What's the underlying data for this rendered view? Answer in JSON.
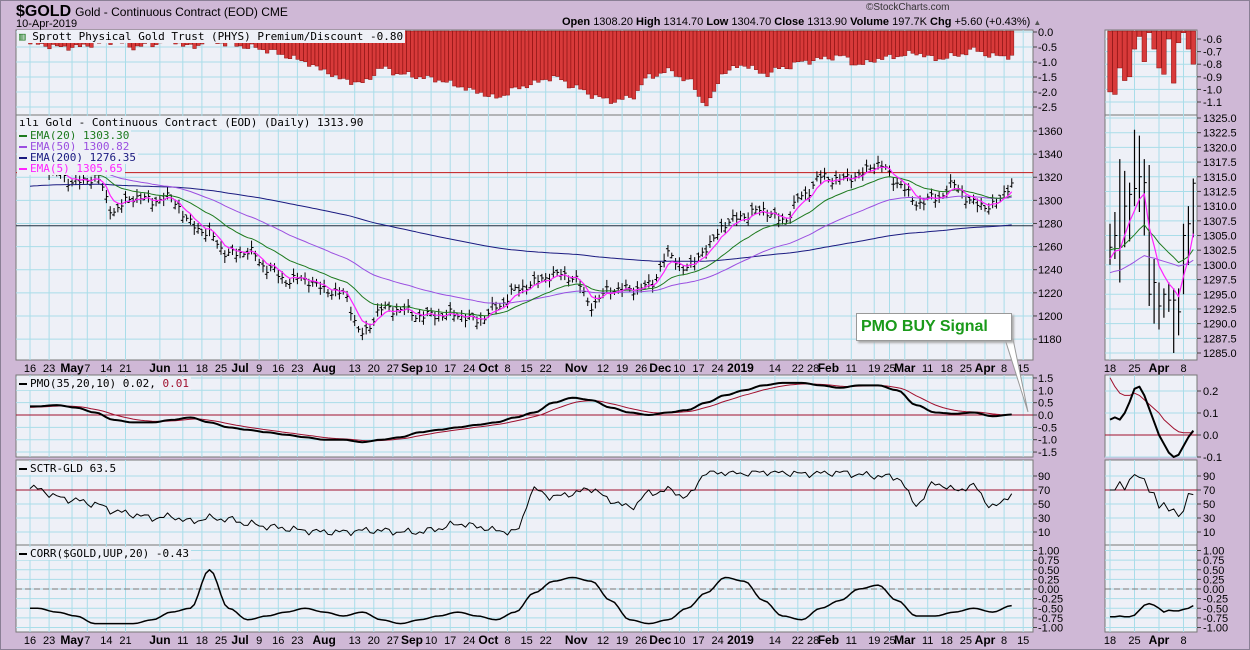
{
  "header": {
    "symbol": "$GOLD",
    "description": "Gold - Continuous Contract (EOD)",
    "exchange": "CME",
    "date": "10-Apr-2019",
    "brand": "©StockCharts.com",
    "open_label": "Open",
    "open": "1308.20",
    "high_label": "High",
    "high": "1314.70",
    "low_label": "Low",
    "low": "1304.70",
    "close_label": "Close",
    "close": "1313.90",
    "volume_label": "Volume",
    "volume": "197.7K",
    "chg_label": "Chg",
    "chg": "+5.60 (+0.43%)"
  },
  "panels": {
    "phys": {
      "label": "Sprott Physical Gold Trust (PHYS) Premium/Discount -0.80"
    },
    "price": {
      "label": "Gold - Continuous Contract (EOD) (Daily) 1313.90",
      "ema20": "EMA(20) 1303.30",
      "ema50": "EMA(50) 1300.82",
      "ema200": "EMA(200) 1276.35",
      "ema5": "EMA(5) 1305.65"
    },
    "pmo": {
      "label": "PMO(35,20,10) 0.02,",
      "signal_label": "0.01"
    },
    "sctr": {
      "label": "SCTR-GLD 63.5"
    },
    "corr": {
      "label": "CORR($GOLD,UUP,20) -0.43"
    }
  },
  "annotation": {
    "text": "PMO BUY Signal"
  },
  "colors": {
    "bar": "#d83a3a",
    "ema20": "#1e7a1e",
    "ema50": "#9b4fe0",
    "ema200": "#1a1a80",
    "ema5": "#ff22ff",
    "signal": "#a0102e",
    "grid": "#a9dde9",
    "panel": "#eef0f7"
  },
  "chart_data": [
    {
      "type": "line",
      "title": "Gold - Continuous Contract (EOD) (Daily)",
      "note": "weekly closes, week starting 16-Apr-2018 through week of 8-Apr-2019",
      "weekly_close": [
        1335,
        1323,
        1315,
        1320,
        1291,
        1303,
        1300,
        1302,
        1280,
        1270,
        1253,
        1256,
        1242,
        1231,
        1232,
        1223,
        1219,
        1184,
        1206,
        1206,
        1200,
        1201,
        1201,
        1196,
        1207,
        1222,
        1229,
        1236,
        1234,
        1210,
        1223,
        1223,
        1226,
        1252,
        1241,
        1258,
        1280,
        1287,
        1292,
        1282,
        1303,
        1320,
        1318,
        1322,
        1332,
        1316,
        1298,
        1302,
        1313,
        1297,
        1295,
        1314
      ],
      "yticks": [
        "1360",
        "1340",
        "1320",
        "1300",
        "1280",
        "1260",
        "1240",
        "1220",
        "1200",
        "1180"
      ],
      "ylim": [
        1165,
        1372
      ],
      "hlines": [
        1324,
        1278
      ]
    },
    {
      "type": "bar",
      "title": "Sprott Physical Gold Trust (PHYS) Premium/Discount",
      "weekly_values": [
        -0.4,
        -0.5,
        -0.5,
        -0.4,
        -0.3,
        -0.5,
        -0.4,
        -0.3,
        -0.5,
        -0.3,
        -0.4,
        -0.5,
        -0.6,
        -0.8,
        -1.0,
        -1.3,
        -1.6,
        -1.7,
        -1.2,
        -1.4,
        -1.5,
        -1.6,
        -1.8,
        -2.0,
        -2.2,
        -1.9,
        -1.7,
        -1.5,
        -1.8,
        -2.1,
        -2.3,
        -2.2,
        -1.5,
        -1.3,
        -1.6,
        -2.4,
        -1.3,
        -1.1,
        -1.4,
        -1.2,
        -1.0,
        -0.9,
        -0.8,
        -1.1,
        -0.9,
        -0.8,
        -0.7,
        -0.9,
        -0.8,
        -0.6,
        -0.8,
        -0.8
      ],
      "yticks": [
        "0.0",
        "-0.5",
        "-1.0",
        "-1.5",
        "-2.0",
        "-2.5"
      ]
    },
    {
      "type": "line",
      "title": "PMO(35,20,10)",
      "weekly_values": [
        0.35,
        0.4,
        0.3,
        0.1,
        -0.2,
        -0.3,
        -0.3,
        -0.2,
        -0.1,
        -0.3,
        -0.5,
        -0.6,
        -0.7,
        -0.8,
        -0.9,
        -1.0,
        -1.0,
        -1.1,
        -1.0,
        -0.9,
        -0.7,
        -0.6,
        -0.5,
        -0.4,
        -0.3,
        -0.1,
        0.1,
        0.5,
        0.7,
        0.6,
        0.3,
        0.1,
        0.0,
        0.1,
        0.2,
        0.5,
        0.8,
        1.0,
        1.2,
        1.3,
        1.3,
        1.2,
        1.1,
        1.2,
        1.2,
        1.0,
        0.4,
        0.1,
        0.05,
        0.1,
        -0.05,
        0.02
      ],
      "yticks": [
        "1.5",
        "1.0",
        "0.5",
        "0.0",
        "-0.5",
        "-1.0",
        "-1.5"
      ],
      "hline": 0
    },
    {
      "type": "line",
      "title": "SCTR-GLD",
      "weekly_values": [
        72,
        60,
        55,
        50,
        40,
        35,
        30,
        32,
        25,
        30,
        28,
        22,
        18,
        15,
        12,
        10,
        10,
        12,
        12,
        10,
        10,
        15,
        22,
        18,
        12,
        10,
        70,
        60,
        65,
        72,
        55,
        45,
        65,
        70,
        60,
        95,
        95,
        94,
        96,
        95,
        93,
        94,
        95,
        92,
        90,
        88,
        50,
        80,
        70,
        75,
        45,
        63.5
      ],
      "yticks": [
        "90",
        "70",
        "50",
        "30",
        "10"
      ],
      "hline": 70
    },
    {
      "type": "line",
      "title": "CORR($GOLD,UUP,20)",
      "weekly_values": [
        -0.5,
        -0.6,
        -0.7,
        -0.9,
        -0.9,
        -0.9,
        -0.8,
        -0.6,
        -0.5,
        0.5,
        -0.5,
        -0.8,
        -0.7,
        -0.6,
        -0.5,
        -0.6,
        -0.7,
        -0.6,
        -0.8,
        -0.9,
        -0.8,
        -0.7,
        -0.6,
        -0.7,
        -0.8,
        -0.6,
        -0.1,
        0.2,
        0.3,
        0.2,
        -0.3,
        -0.8,
        -0.9,
        -0.8,
        -0.5,
        -0.1,
        0.3,
        0.2,
        -0.3,
        -0.7,
        -0.8,
        -0.5,
        -0.3,
        0.0,
        0.1,
        -0.3,
        -0.7,
        -0.7,
        -0.6,
        -0.5,
        -0.6,
        -0.43
      ],
      "yticks": [
        "1.00",
        "0.75",
        "0.50",
        "0.25",
        "0.00",
        "-0.25",
        "-0.50",
        "-0.75",
        "-1.00"
      ]
    }
  ],
  "x_ticks": [
    {
      "label": "16",
      "day": 0
    },
    {
      "label": "23",
      "day": 5
    },
    {
      "label": "May",
      "day": 11,
      "bold": true
    },
    {
      "label": "7",
      "day": 15
    },
    {
      "label": "14",
      "day": 20
    },
    {
      "label": "21",
      "day": 25
    },
    {
      "label": "Jun",
      "day": 34,
      "bold": true
    },
    {
      "label": "11",
      "day": 40
    },
    {
      "label": "18",
      "day": 45
    },
    {
      "label": "25",
      "day": 50
    },
    {
      "label": "Jul",
      "day": 55,
      "bold": true
    },
    {
      "label": "9",
      "day": 60
    },
    {
      "label": "16",
      "day": 65
    },
    {
      "label": "23",
      "day": 70
    },
    {
      "label": "Aug",
      "day": 77,
      "bold": true
    },
    {
      "label": "13",
      "day": 85
    },
    {
      "label": "20",
      "day": 90
    },
    {
      "label": "27",
      "day": 95
    },
    {
      "label": "Sep",
      "day": 100,
      "bold": true
    },
    {
      "label": "10",
      "day": 105
    },
    {
      "label": "17",
      "day": 110
    },
    {
      "label": "24",
      "day": 115
    },
    {
      "label": "Oct",
      "day": 120,
      "bold": true
    },
    {
      "label": "8",
      "day": 125
    },
    {
      "label": "15",
      "day": 130
    },
    {
      "label": "22",
      "day": 135
    },
    {
      "label": "Nov",
      "day": 143,
      "bold": true
    },
    {
      "label": "12",
      "day": 150
    },
    {
      "label": "19",
      "day": 155
    },
    {
      "label": "26",
      "day": 160
    },
    {
      "label": "Dec",
      "day": 165,
      "bold": true
    },
    {
      "label": "10",
      "day": 170
    },
    {
      "label": "17",
      "day": 175
    },
    {
      "label": "24",
      "day": 180
    },
    {
      "label": "2019",
      "day": 186,
      "bold": true
    },
    {
      "label": "14",
      "day": 195
    },
    {
      "label": "22",
      "day": 201
    },
    {
      "label": "28",
      "day": 205
    },
    {
      "label": "Feb",
      "day": 209,
      "bold": true
    },
    {
      "label": "11",
      "day": 215
    },
    {
      "label": "19",
      "day": 221
    },
    {
      "label": "25",
      "day": 225
    },
    {
      "label": "Mar",
      "day": 229,
      "bold": true
    },
    {
      "label": "11",
      "day": 235
    },
    {
      "label": "18",
      "day": 240
    },
    {
      "label": "25",
      "day": 245
    },
    {
      "label": "Apr",
      "day": 250,
      "bold": true
    },
    {
      "label": "8",
      "day": 255
    },
    {
      "label": "15",
      "day": 260
    }
  ],
  "inset": {
    "x_ticks": [
      {
        "label": "18",
        "day": 0
      },
      {
        "label": "25",
        "day": 5
      },
      {
        "label": "Apr",
        "day": 10,
        "bold": true
      },
      {
        "label": "8",
        "day": 15
      }
    ],
    "price": {
      "high": [
        1307,
        1309,
        1318,
        1316,
        1314,
        1323,
        1322,
        1318,
        1317,
        1301,
        1297,
        1296,
        1297,
        1296,
        1296,
        1307,
        1310,
        1314.7
      ],
      "low": [
        1300,
        1301,
        1297,
        1303,
        1304,
        1310,
        1309,
        1305,
        1293,
        1290,
        1289,
        1291,
        1292,
        1285,
        1288,
        1295,
        1300,
        1304.7
      ],
      "close": [
        1303,
        1305,
        1303,
        1310,
        1312,
        1313,
        1315,
        1314,
        1295,
        1297,
        1293,
        1295,
        1294,
        1294,
        1292,
        1305,
        1307,
        1313.9
      ],
      "yticks": [
        "1325.0",
        "1322.5",
        "1320.0",
        "1317.5",
        "1315.0",
        "1312.5",
        "1310.0",
        "1307.5",
        "1305.0",
        "1302.5",
        "1300.0",
        "1297.5",
        "1295.0",
        "1292.5",
        "1290.0",
        "1287.5",
        "1285.0"
      ]
    },
    "phys": {
      "values": [
        -1.02,
        -1.04,
        -0.83,
        -0.93,
        -0.9,
        -0.68,
        -0.58,
        -0.78,
        -0.55,
        -0.68,
        -0.83,
        -0.88,
        -0.6,
        -0.95,
        -0.63,
        -0.55,
        -0.68,
        -0.8
      ],
      "yticks": [
        "-0.6",
        "-0.7",
        "-0.8",
        "-0.9",
        "-1.0",
        "-1.1"
      ]
    },
    "pmo": {
      "values": [
        0.07,
        0.08,
        0.07,
        0.1,
        0.15,
        0.21,
        0.22,
        0.18,
        0.12,
        0.06,
        0.0,
        -0.04,
        -0.08,
        -0.1,
        -0.09,
        -0.05,
        -0.01,
        0.02
      ],
      "signal": [
        0.26,
        0.22,
        0.19,
        0.18,
        0.18,
        0.19,
        0.18,
        0.16,
        0.14,
        0.12,
        0.1,
        0.07,
        0.05,
        0.03,
        0.015,
        0.01,
        0.01,
        0.01
      ],
      "yticks": [
        "0.2",
        "0.1",
        "0.0",
        "-0.1"
      ]
    },
    "sctr": {
      "values": [
        70,
        70,
        82,
        70,
        85,
        92,
        88,
        86,
        67,
        66,
        44,
        52,
        40,
        43,
        32,
        40,
        65,
        63.5
      ]
    },
    "corr": {
      "values": [
        -0.72,
        -0.72,
        -0.7,
        -0.72,
        -0.72,
        -0.68,
        -0.55,
        -0.42,
        -0.38,
        -0.42,
        -0.5,
        -0.6,
        -0.55,
        -0.57,
        -0.57,
        -0.53,
        -0.5,
        -0.43
      ]
    }
  }
}
